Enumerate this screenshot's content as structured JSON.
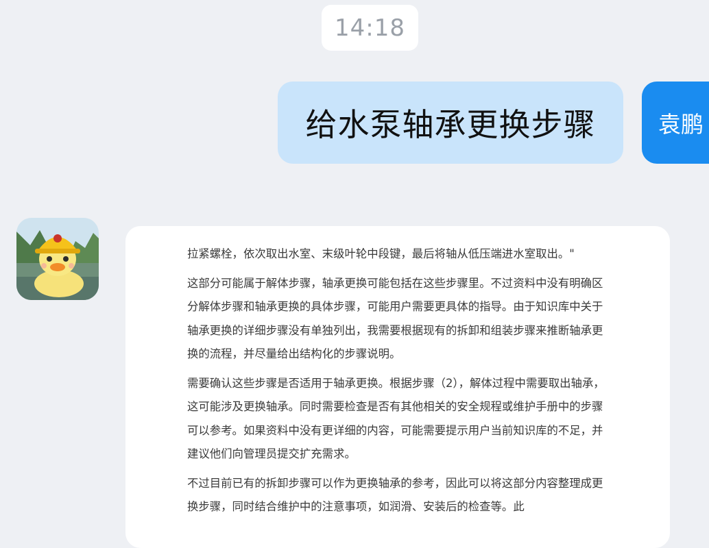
{
  "chat": {
    "timestamp": "14:18",
    "user_message": {
      "text": "给水泵轴承更换步骤",
      "avatar_label": "袁鹏"
    },
    "bot_message": {
      "avatar_icon": "yellow-duck-helmet-avatar",
      "paragraphs": [
        "拉紧螺栓，依次取出水室、末级叶轮中段键，最后将轴从低压端进水室取出。\"",
        "这部分可能属于解体步骤，轴承更换可能包括在这些步骤里。不过资料中没有明确区分解体步骤和轴承更换的具体步骤，可能用户需要更具体的指导。由于知识库中关于轴承更换的详细步骤没有单独列出，我需要根据现有的拆卸和组装步骤来推断轴承更换的流程，并尽量给出结构化的步骤说明。",
        "需要确认这些步骤是否适用于轴承更换。根据步骤（2），解体过程中需要取出轴承，这可能涉及更换轴承。同时需要检查是否有其他相关的安全规程或维护手册中的步骤可以参考。如果资料中没有更详细的内容，可能需要提示用户当前知识库的不足，并建议他们向管理员提交扩充需求。",
        "不过目前已有的拆卸步骤可以作为更换轴承的参考，因此可以将这部分内容整理成更换步骤，同时结合维护中的注意事项，如润滑、安装后的检查等。此"
      ]
    }
  },
  "colors": {
    "background": "#eef0f4",
    "user_bubble": "#c9e4fb",
    "user_avatar": "#1a8cf0",
    "bot_bubble": "#ffffff",
    "timestamp_text": "#9aa0a8"
  }
}
